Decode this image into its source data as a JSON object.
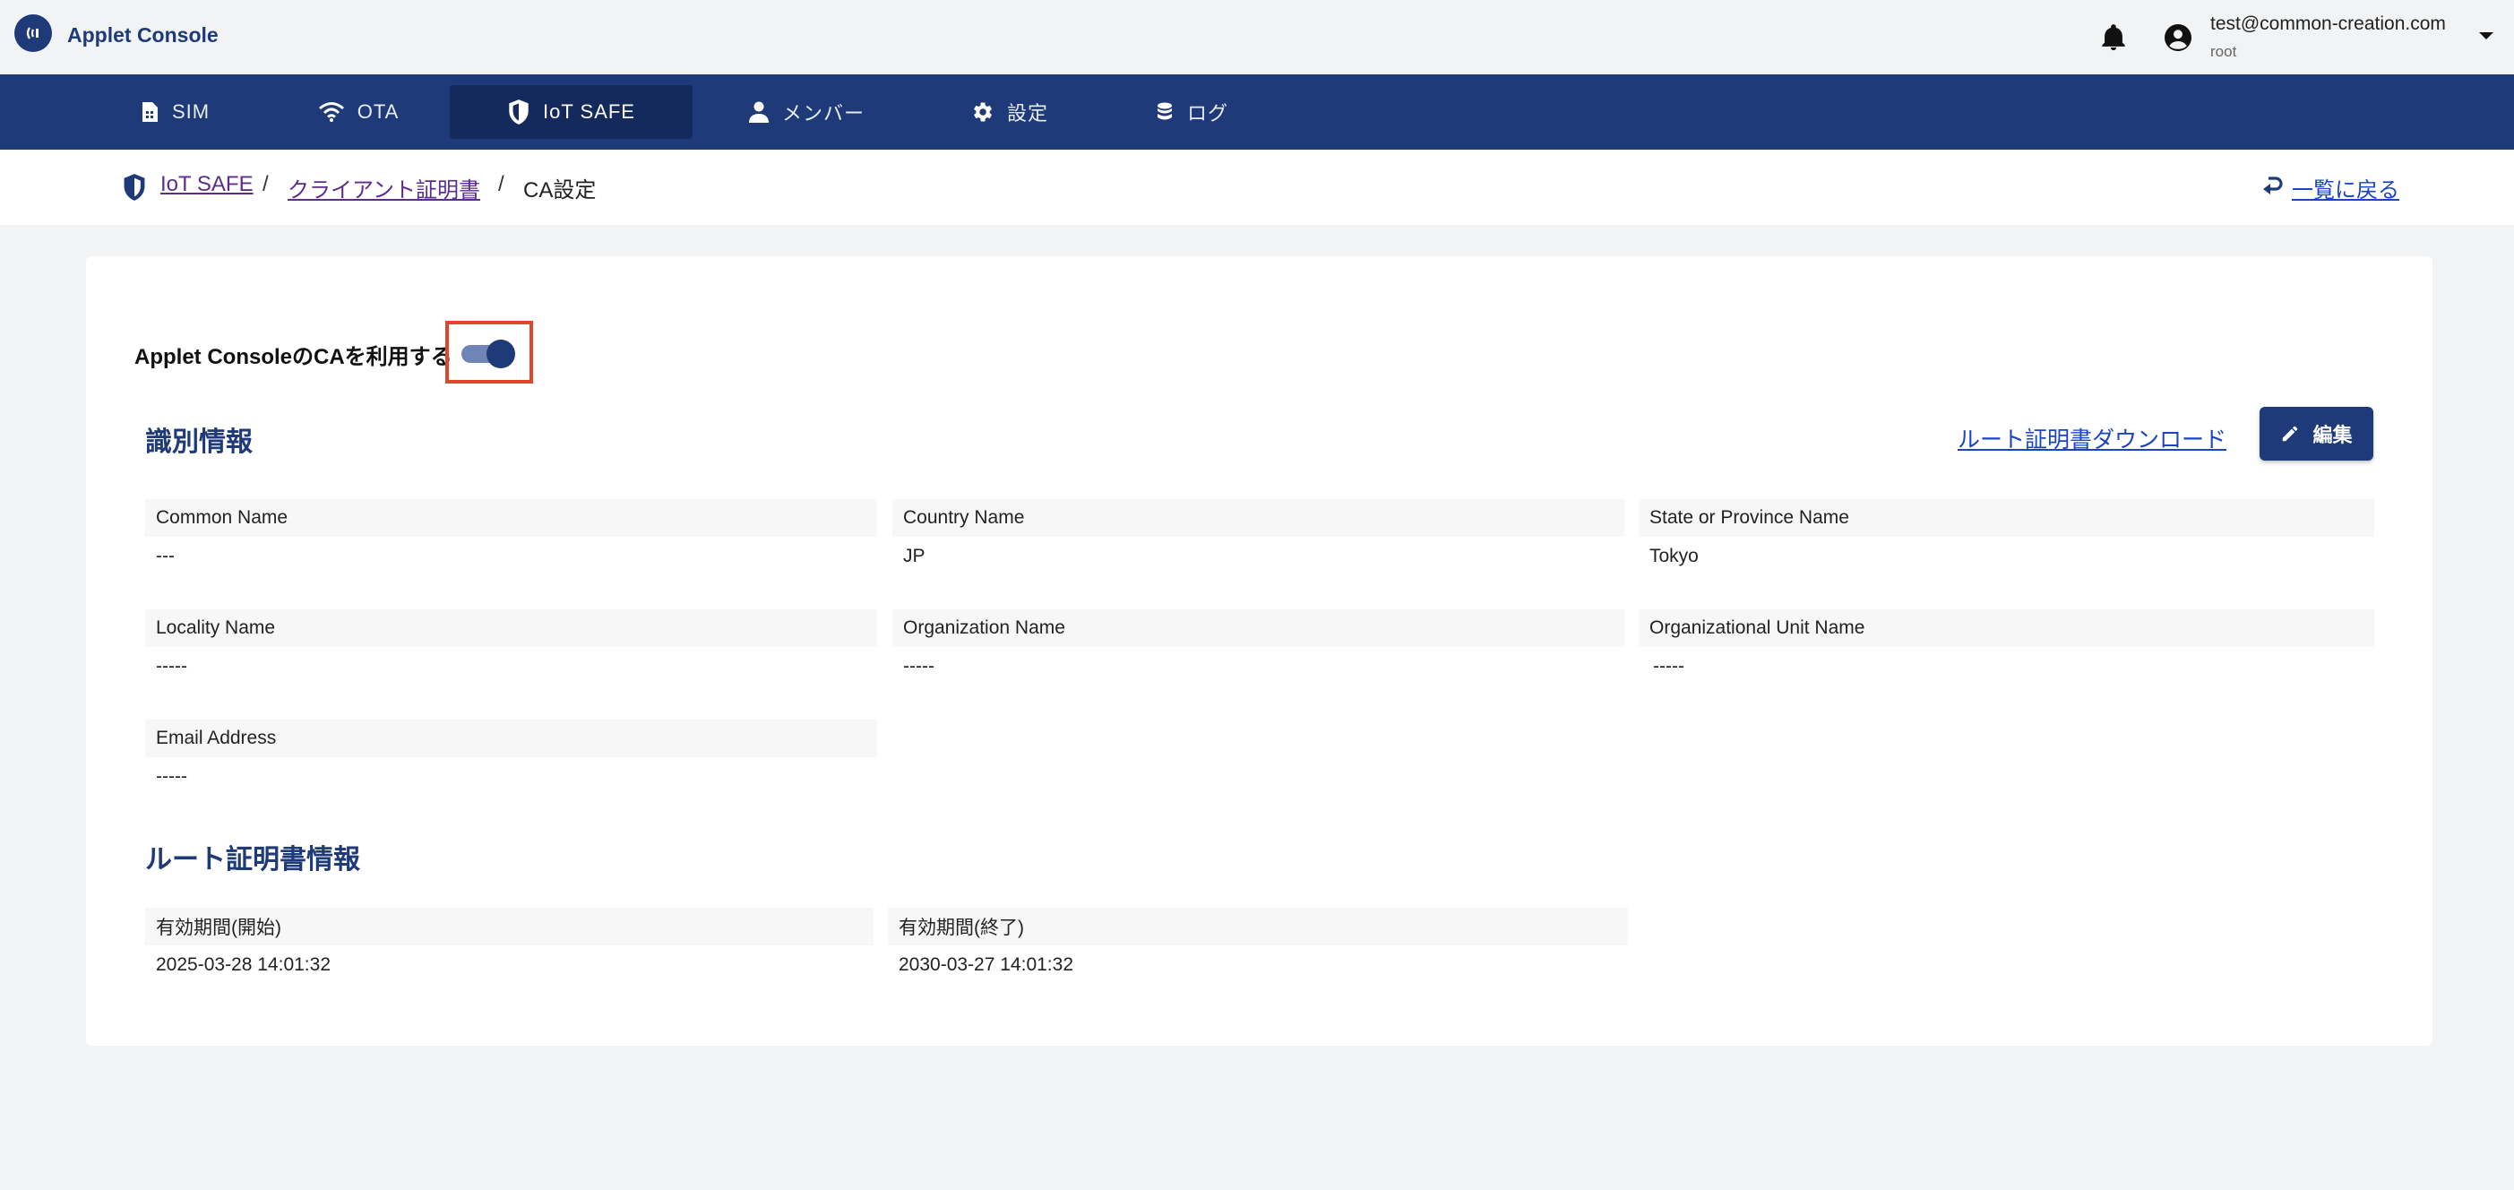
{
  "header": {
    "app_title": "Applet Console",
    "user_email": "test@common-creation.com",
    "user_role": "root"
  },
  "nav": {
    "items": [
      {
        "label": "SIM",
        "icon": "sim-card-icon"
      },
      {
        "label": "OTA",
        "icon": "wifi-icon"
      },
      {
        "label": "IoT SAFE",
        "icon": "shield-icon",
        "active": true
      },
      {
        "label": "メンバー",
        "icon": "person-icon"
      },
      {
        "label": "設定",
        "icon": "gear-icon"
      },
      {
        "label": "ログ",
        "icon": "database-icon"
      }
    ]
  },
  "breadcrumb": {
    "items": [
      "IoT SAFE",
      "クライアント証明書"
    ],
    "separator": "/",
    "current": "CA設定",
    "back_label": "一覧に戻る"
  },
  "ca_toggle": {
    "label": "Applet ConsoleのCAを利用する",
    "enabled": true
  },
  "identity": {
    "title": "識別情報",
    "download_label": "ルート証明書ダウンロード",
    "edit_label": "編集",
    "fields": [
      {
        "label": "Common Name",
        "value": "---"
      },
      {
        "label": "Country Name",
        "value": "JP"
      },
      {
        "label": "State or Province Name",
        "value": "Tokyo"
      },
      {
        "label": "Locality Name",
        "value": "-----"
      },
      {
        "label": "Organization Name",
        "value": "-----"
      },
      {
        "label": "Organizational Unit Name",
        "value": "-----"
      },
      {
        "label": "Email Address",
        "value": "-----"
      }
    ]
  },
  "root_cert": {
    "title": "ルート証明書情報",
    "fields": [
      {
        "label": "有効期間(開始)",
        "value": "2025-03-28 14:01:32"
      },
      {
        "label": "有効期間(終了)",
        "value": "2030-03-27 14:01:32"
      }
    ]
  },
  "colors": {
    "brand": "#1e3a78",
    "highlight": "#e2442c",
    "link": "#1a44c4"
  }
}
